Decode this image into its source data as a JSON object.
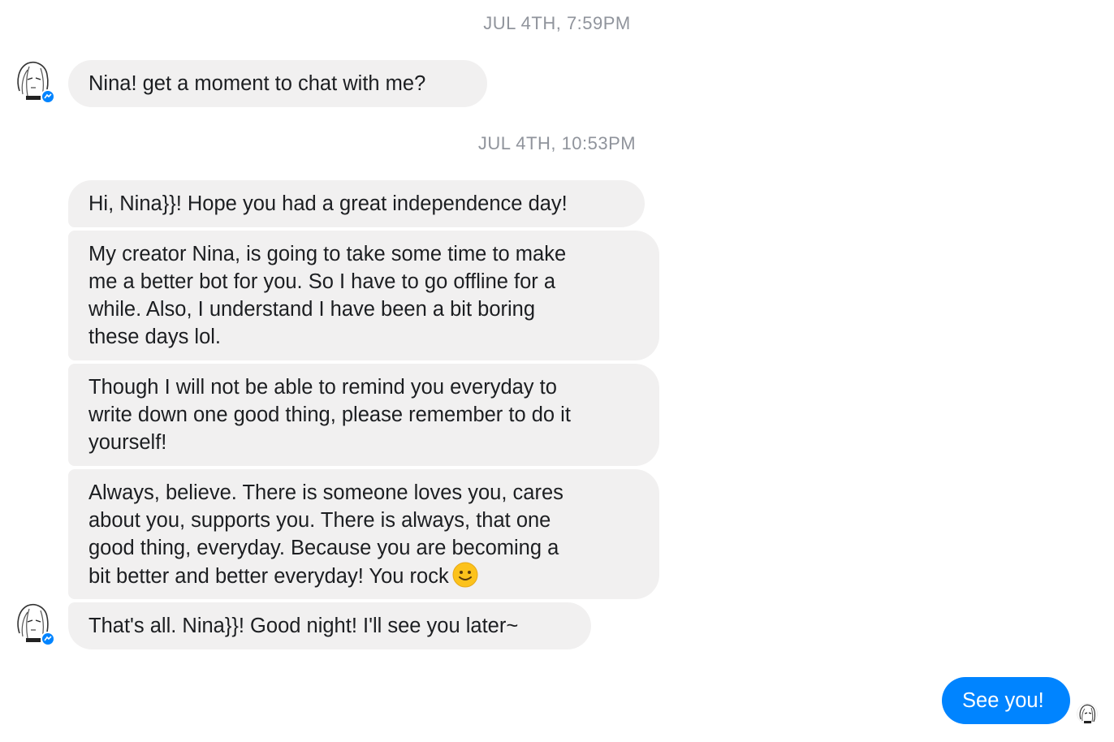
{
  "timestamps": [
    "JUL 4TH, 7:59PM",
    "JUL 4TH, 10:53PM"
  ],
  "messages": [
    "Nina! get a moment to chat with me?",
    "Hi, Nina}}! Hope you had a great independence day!",
    "My creator Nina, is going to take some time to make\nme a better bot for you. So I have to go offline for a\nwhile. Also, I understand I have been a bit boring\nthese days lol.",
    "Though I will not be able to remind you everyday to\nwrite down one good thing, please remember to do it\nyourself!",
    "Always, believe. There is someone loves you, cares\nabout you, supports you. There is always, that one\ngood thing, everyday. Because you are becoming a\nbit better and better everyday! You rock",
    "That's all. Nina}}! Good night! I'll see you later~",
    "See you!"
  ],
  "icons": {
    "avatar": "manga-girl-avatar",
    "badge": "messenger-badge-icon",
    "emoji": "slightly-smiling-face-emoji"
  },
  "colors": {
    "incoming_bubble": "#f1f0f0",
    "outgoing_bubble": "#0084ff",
    "timestamp": "#90949c"
  }
}
